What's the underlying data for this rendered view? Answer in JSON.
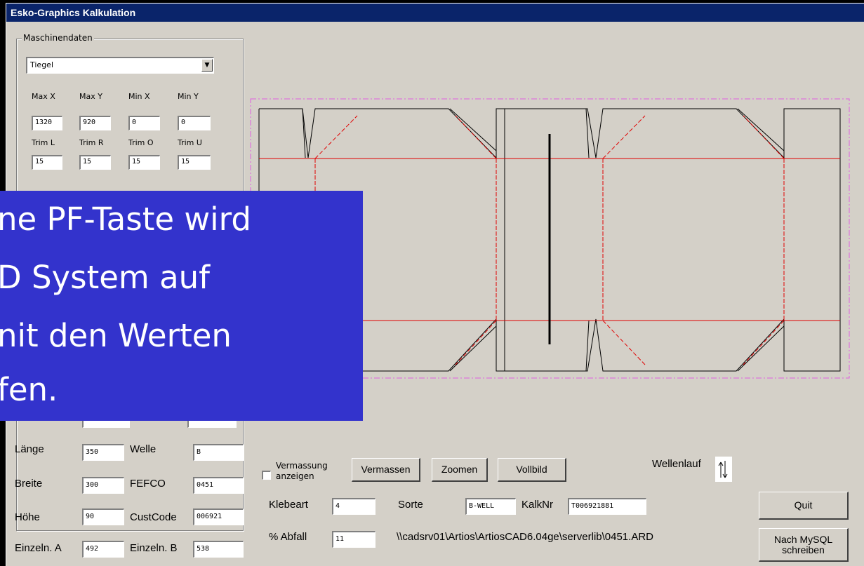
{
  "window": {
    "title": "Esko-Graphics Kalkulation"
  },
  "maschinendaten": {
    "group_title": "Maschinendaten",
    "machine_select": "Tiegel",
    "labels": {
      "max_x": "Max X",
      "max_y": "Max Y",
      "min_x": "Min X",
      "min_y": "Min Y",
      "trim_l": "Trim L",
      "trim_r": "Trim R",
      "trim_o": "Trim O",
      "trim_u": "Trim U"
    },
    "values": {
      "max_x": "1320",
      "max_y": "920",
      "min_x": "0",
      "min_y": "0",
      "trim_l": "15",
      "trim_r": "15",
      "trim_o": "15",
      "trim_u": "15"
    }
  },
  "box": {
    "labels": {
      "laenge": "Länge",
      "breite": "Breite",
      "hoehe": "Höhe",
      "einzeln_a": "Einzeln. A",
      "welle": "Welle",
      "fefco": "FEFCO",
      "custcode": "CustCode",
      "einzeln_b": "Einzeln. B"
    },
    "values": {
      "laenge": "350",
      "breite": "300",
      "hoehe": "90",
      "einzeln_a": "492",
      "welle": "B",
      "fefco": "0451",
      "custcode": "006921",
      "einzeln_b": "538"
    }
  },
  "controls": {
    "vermassung_label": "Vermassung anzeigen",
    "vermassen": "Vermassen",
    "zoomen": "Zoomen",
    "vollbild": "Vollbild",
    "wellenlauf": "Wellenlauf",
    "klebeart_label": "Klebeart",
    "klebeart_value": "4",
    "sorte_label": "Sorte",
    "sorte_value": "B-WELL",
    "kalknr_label": "KalkNr",
    "kalknr_value": "T006921881",
    "abfall_label": "% Abfall",
    "abfall_value": "11",
    "file_path": "\\\\cadsrv01\\Artios\\ArtiosCAD6.04ge\\serverlib\\0451.ARD",
    "quit": "Quit",
    "mysql": "Nach MySQL schreiben"
  },
  "overlay": {
    "lines": [
      "ne PF-Taste wird",
      "D System auf",
      "nit den Werten",
      "fen."
    ],
    "background": "#3333cc"
  },
  "colors": {
    "title_bar": "#0a246a",
    "face": "#d4d0c8",
    "cut_line": "#000000",
    "crease_line": "#e00000",
    "border_dash": "#e060e0"
  }
}
